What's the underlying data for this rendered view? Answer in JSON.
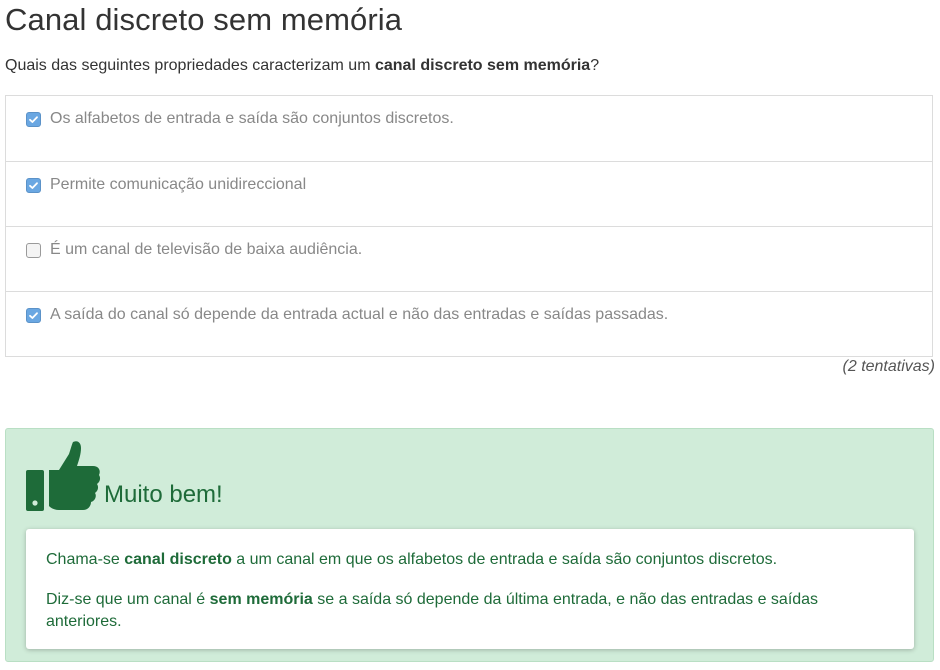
{
  "title": "Canal discreto sem memória",
  "question": {
    "prefix": "Quais das seguintes propriedades caracterizam um ",
    "bold": "canal discreto sem memória",
    "suffix": "?"
  },
  "options": [
    {
      "label": "Os alfabetos de entrada e saída são conjuntos discretos.",
      "checked": true
    },
    {
      "label": "Permite comunicação unidireccional",
      "checked": true
    },
    {
      "label": "É um canal de televisão de baixa audiência.",
      "checked": false
    },
    {
      "label": "A saída do canal só depende da entrada actual e não das entradas e saídas passadas.",
      "checked": true
    }
  ],
  "attempts": "(2 tentativas)",
  "feedback": {
    "title": "Muito bem!",
    "line1": {
      "a": "Chama-se ",
      "b": "canal discreto",
      "c": " a um canal em que os alfabetos de entrada e saída são conjuntos discretos."
    },
    "line2": {
      "a": "Diz-se que um canal é ",
      "b": "sem memória",
      "c": " se a saída só depende da última entrada, e não das entradas e saídas anteriores."
    },
    "icon": "thumbs-up-icon",
    "color": "#1e6b39",
    "background": "#d0ecd9"
  },
  "colors": {
    "checkbox_checked": "#6aa7e2"
  }
}
